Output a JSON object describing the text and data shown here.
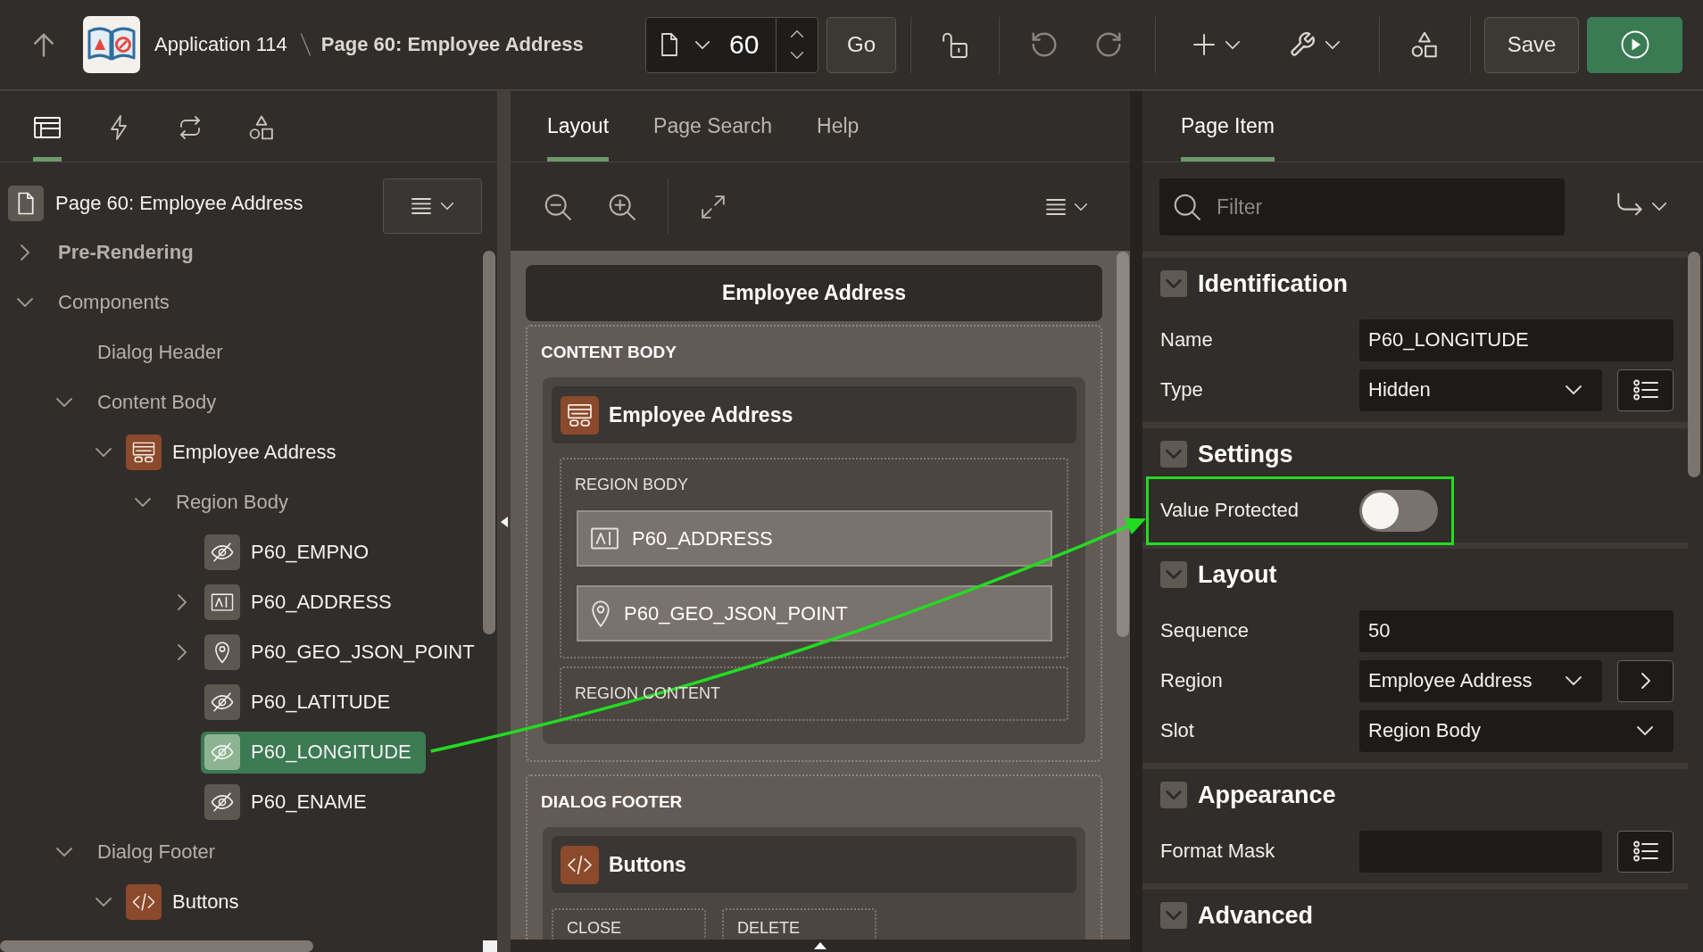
{
  "header": {
    "app_name": "Application 114",
    "page_title": "Page 60: Employee Address",
    "page_number": "60",
    "go_label": "Go",
    "undo": {
      "disabled": true
    },
    "redo": {
      "disabled": true
    },
    "save_label": "Save"
  },
  "left_tabs": [
    {
      "kind": "rendering",
      "selected": true
    },
    {
      "kind": "actions",
      "selected": false
    },
    {
      "kind": "processing",
      "selected": false
    },
    {
      "kind": "shared",
      "selected": false
    }
  ],
  "tree": {
    "page": "Page 60: Employee Address",
    "nodes": [
      {
        "label": "Pre-Rendering",
        "kind": "section",
        "expanded": false,
        "selected": false
      },
      {
        "label": "Components",
        "kind": "group",
        "expanded": true,
        "selected": false,
        "children": [
          {
            "label": "Dialog Header",
            "kind": "group",
            "selected": false
          },
          {
            "label": "Content Body",
            "kind": "group",
            "expanded": true,
            "selected": false,
            "children": [
              {
                "label": "Employee Address",
                "kind": "region",
                "expanded": true,
                "selected": false,
                "children": [
                  {
                    "label": "Region Body",
                    "kind": "group",
                    "expanded": true,
                    "selected": false,
                    "children": [
                      {
                        "label": "P60_EMPNO",
                        "kind": "hidden",
                        "selected": false
                      },
                      {
                        "label": "P60_ADDRESS",
                        "kind": "textfield",
                        "expanded": false,
                        "selected": false
                      },
                      {
                        "label": "P60_GEO_JSON_POINT",
                        "kind": "geopoint",
                        "expanded": false,
                        "selected": false
                      },
                      {
                        "label": "P60_LATITUDE",
                        "kind": "hidden",
                        "selected": false
                      },
                      {
                        "label": "P60_LONGITUDE",
                        "kind": "hidden",
                        "selected": true
                      },
                      {
                        "label": "P60_ENAME",
                        "kind": "hidden",
                        "selected": false
                      }
                    ]
                  }
                ]
              }
            ]
          },
          {
            "label": "Dialog Footer",
            "kind": "group",
            "expanded": true,
            "selected": false,
            "children": [
              {
                "label": "Buttons",
                "kind": "buttons",
                "expanded": true,
                "selected": false
              }
            ]
          }
        ]
      }
    ]
  },
  "designer": {
    "tabs": [
      {
        "label": "Layout",
        "selected": true
      },
      {
        "label": "Page Search",
        "selected": false
      },
      {
        "label": "Help",
        "selected": false
      }
    ],
    "canvas": {
      "dialog_title": "Employee Address",
      "sections": [
        {
          "label": "CONTENT BODY",
          "regions": [
            {
              "kind": "region",
              "title": "Employee Address",
              "slots": [
                {
                  "label": "REGION BODY",
                  "items": [
                    {
                      "kind": "textfield",
                      "label": "P60_ADDRESS"
                    },
                    {
                      "kind": "geopoint",
                      "label": "P60_GEO_JSON_POINT"
                    }
                  ]
                },
                {
                  "label": "REGION CONTENT"
                }
              ]
            }
          ]
        },
        {
          "label": "DIALOG FOOTER",
          "regions": [
            {
              "kind": "buttons",
              "title": "Buttons",
              "slots": [
                {
                  "label": "CLOSE"
                },
                {
                  "label": "DELETE"
                }
              ]
            }
          ]
        }
      ]
    }
  },
  "property_editor": {
    "tab": {
      "label": "Page Item",
      "selected": true
    },
    "filter": {
      "placeholder": "Filter"
    },
    "groups": [
      {
        "title": "Identification",
        "expanded": true,
        "properties": [
          {
            "label": "Name",
            "kind": "text",
            "value": "P60_LONGITUDE",
            "highlighted": false
          },
          {
            "label": "Type",
            "kind": "select",
            "value": "Hidden",
            "side_button": {
              "kind": "list"
            },
            "highlighted": false
          }
        ]
      },
      {
        "title": "Settings",
        "expanded": true,
        "properties": [
          {
            "label": "Value Protected",
            "kind": "switch",
            "on": false,
            "highlighted": true
          }
        ]
      },
      {
        "title": "Layout",
        "expanded": true,
        "properties": [
          {
            "label": "Sequence",
            "kind": "text",
            "value": "50",
            "highlighted": false
          },
          {
            "label": "Region",
            "kind": "select",
            "value": "Employee Address",
            "side_button": {
              "kind": "goto"
            },
            "highlighted": false
          },
          {
            "label": "Slot",
            "kind": "select",
            "value": "Region Body",
            "highlighted": false
          }
        ]
      },
      {
        "title": "Appearance",
        "expanded": true,
        "properties": [
          {
            "label": "Format Mask",
            "kind": "text",
            "side_button": {
              "kind": "list"
            },
            "highlighted": false
          }
        ]
      },
      {
        "title": "Advanced",
        "expanded": true
      }
    ]
  }
}
